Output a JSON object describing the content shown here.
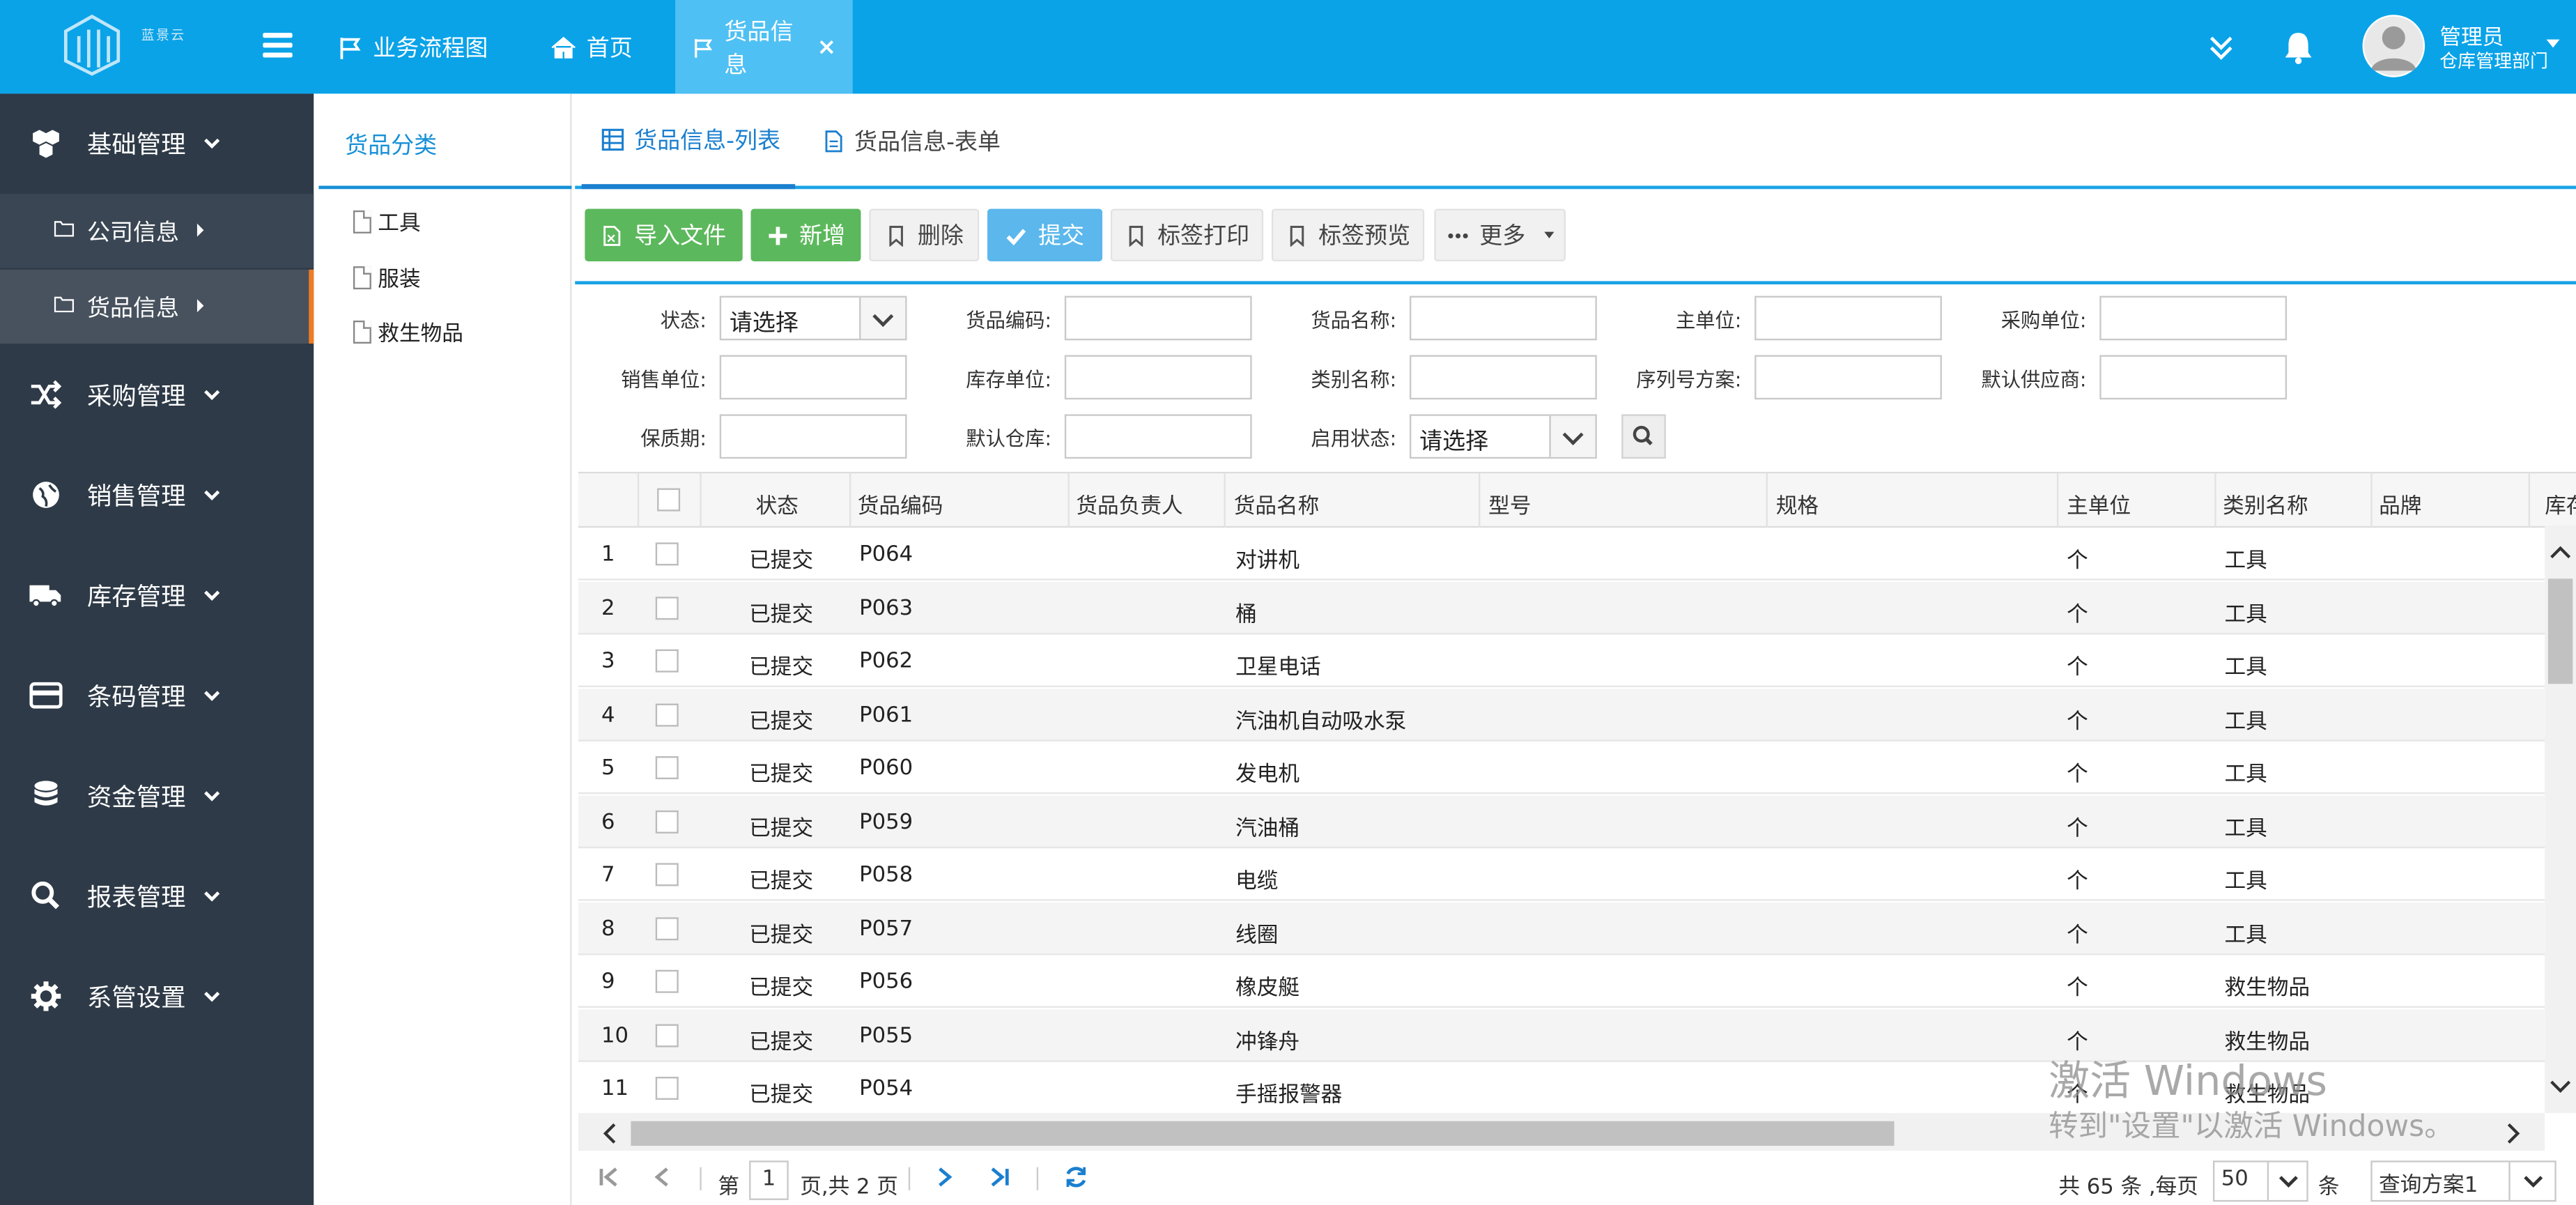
{
  "header": {
    "logo_text": "蓝景云",
    "nav_tabs": [
      {
        "label": "业务流程图"
      },
      {
        "label": "首页"
      },
      {
        "label": "货品信息"
      }
    ],
    "user": {
      "name": "管理员",
      "dept": "仓库管理部门"
    }
  },
  "sidebar": {
    "items": [
      {
        "label": "基础管理",
        "icon": "cubes-icon"
      },
      {
        "label": "采购管理",
        "icon": "shuffle-icon"
      },
      {
        "label": "销售管理",
        "icon": "globe-icon"
      },
      {
        "label": "库存管理",
        "icon": "truck-icon"
      },
      {
        "label": "条码管理",
        "icon": "credit-card-icon"
      },
      {
        "label": "资金管理",
        "icon": "database-icon"
      },
      {
        "label": "报表管理",
        "icon": "search-icon"
      },
      {
        "label": "系管设置",
        "icon": "gear-icon"
      }
    ],
    "subitems": [
      {
        "label": "公司信息"
      },
      {
        "label": "货品信息"
      }
    ]
  },
  "category_panel": {
    "title": "货品分类",
    "items": [
      "工具",
      "服装",
      "救生物品"
    ]
  },
  "main_tabs": [
    {
      "label": "货品信息-列表"
    },
    {
      "label": "货品信息-表单"
    }
  ],
  "toolbar": {
    "import": "导入文件",
    "add": "新增",
    "delete": "删除",
    "submit": "提交",
    "print_label": "标签打印",
    "preview_label": "标签预览",
    "more": "更多"
  },
  "filters": {
    "status": {
      "label": "状态:",
      "value": "请选择"
    },
    "code": {
      "label": "货品编码:"
    },
    "name": {
      "label": "货品名称:"
    },
    "main_unit": {
      "label": "主单位:"
    },
    "purchase_unit": {
      "label": "采购单位:"
    },
    "sales_unit": {
      "label": "销售单位:"
    },
    "stock_unit": {
      "label": "库存单位:"
    },
    "category_name": {
      "label": "类别名称:"
    },
    "serial_scheme": {
      "label": "序列号方案:"
    },
    "default_supplier": {
      "label": "默认供应商:"
    },
    "shelf_life": {
      "label": "保质期:"
    },
    "default_warehouse": {
      "label": "默认仓库:"
    },
    "enabled": {
      "label": "启用状态:",
      "value": "请选择"
    }
  },
  "grid": {
    "columns": [
      "状态",
      "货品编码",
      "货品负责人",
      "货品名称",
      "型号",
      "规格",
      "主单位",
      "类别名称",
      "品牌",
      "库存"
    ],
    "rows": [
      {
        "n": "1",
        "status": "已提交",
        "code": "P064",
        "owner": "",
        "name": "对讲机",
        "unit": "个",
        "category": "工具"
      },
      {
        "n": "2",
        "status": "已提交",
        "code": "P063",
        "owner": "",
        "name": "桶",
        "unit": "个",
        "category": "工具"
      },
      {
        "n": "3",
        "status": "已提交",
        "code": "P062",
        "owner": "",
        "name": "卫星电话",
        "unit": "个",
        "category": "工具"
      },
      {
        "n": "4",
        "status": "已提交",
        "code": "P061",
        "owner": "",
        "name": "汽油机自动吸水泵",
        "unit": "个",
        "category": "工具"
      },
      {
        "n": "5",
        "status": "已提交",
        "code": "P060",
        "owner": "",
        "name": "发电机",
        "unit": "个",
        "category": "工具"
      },
      {
        "n": "6",
        "status": "已提交",
        "code": "P059",
        "owner": "",
        "name": "汽油桶",
        "unit": "个",
        "category": "工具"
      },
      {
        "n": "7",
        "status": "已提交",
        "code": "P058",
        "owner": "",
        "name": "电缆",
        "unit": "个",
        "category": "工具"
      },
      {
        "n": "8",
        "status": "已提交",
        "code": "P057",
        "owner": "",
        "name": "线圈",
        "unit": "个",
        "category": "工具"
      },
      {
        "n": "9",
        "status": "已提交",
        "code": "P056",
        "owner": "",
        "name": "橡皮艇",
        "unit": "个",
        "category": "救生物品"
      },
      {
        "n": "10",
        "status": "已提交",
        "code": "P055",
        "owner": "",
        "name": "冲锋舟",
        "unit": "个",
        "category": "救生物品"
      },
      {
        "n": "11",
        "status": "已提交",
        "code": "P054",
        "owner": "",
        "name": "手摇报警器",
        "unit": "个",
        "category": "救生物品"
      }
    ]
  },
  "pager": {
    "page_prefix": "第",
    "page": "1",
    "page_suffix": "页,共 2 页",
    "total_text": "共 65 条 ,每页",
    "page_size": "50",
    "unit": "条",
    "query_scheme": "查询方案1"
  },
  "watermark": {
    "line1": "激活 Windows",
    "line2": "转到\"设置\"以激活 Windows。"
  },
  "colors": {
    "header": "#0aa3e8",
    "sidebar": "#2e3a47",
    "accent": "#f07c22",
    "link": "#1690d8"
  }
}
